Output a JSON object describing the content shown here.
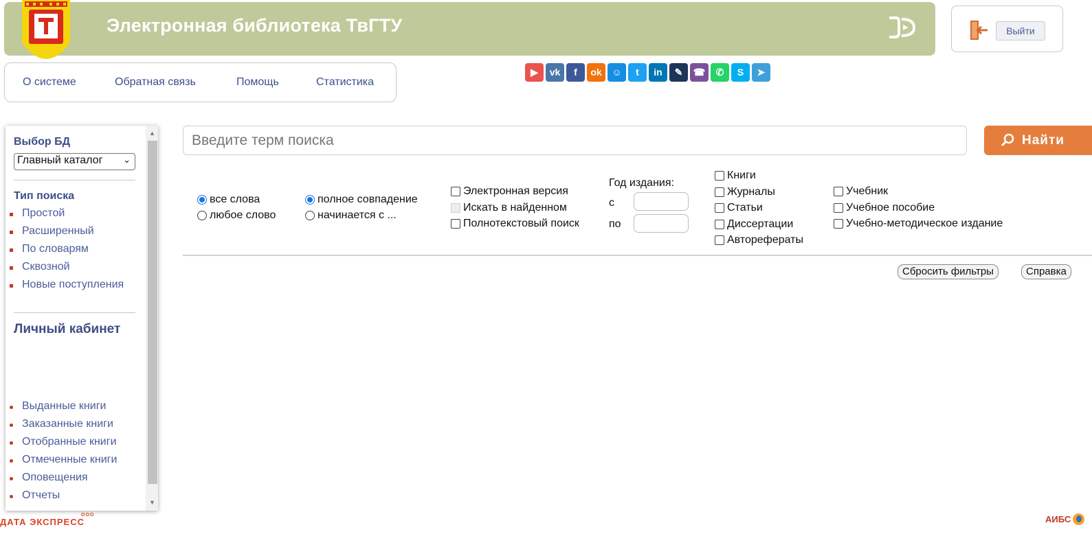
{
  "header": {
    "title": "Электронная библиотека ТвГТУ",
    "logout_label": "Выйти",
    "icons": {
      "logo": "city-coat-of-arms-logo",
      "mark": "reader-mark-icon",
      "logout": "logout-door-icon"
    }
  },
  "topnav": {
    "items": [
      "О системе",
      "Обратная связь",
      "Помощь",
      "Статистика"
    ]
  },
  "share": {
    "buttons": [
      {
        "icon": "share-collection-icon",
        "color": "#e9544f",
        "glyph": "▶"
      },
      {
        "icon": "vk-icon",
        "color": "#4a76a8",
        "glyph": "vk"
      },
      {
        "icon": "facebook-icon",
        "color": "#3b5998",
        "glyph": "f"
      },
      {
        "icon": "odnoklassniki-icon",
        "color": "#f2720c",
        "glyph": "ok"
      },
      {
        "icon": "moimir-icon",
        "color": "#168de2",
        "glyph": "☺"
      },
      {
        "icon": "twitter-icon",
        "color": "#1da1f2",
        "glyph": "t"
      },
      {
        "icon": "linkedin-icon",
        "color": "#0077b5",
        "glyph": "in"
      },
      {
        "icon": "livejournal-icon",
        "color": "#1d3557",
        "glyph": "✎"
      },
      {
        "icon": "viber-icon",
        "color": "#7b519d",
        "glyph": "☎"
      },
      {
        "icon": "whatsapp-icon",
        "color": "#25d366",
        "glyph": "✆"
      },
      {
        "icon": "skype-icon",
        "color": "#00aff0",
        "glyph": "S"
      },
      {
        "icon": "telegram-icon",
        "color": "#3ea0d8",
        "glyph": "➤"
      }
    ]
  },
  "sidebar": {
    "db_heading": "Выбор БД",
    "db_selected": "Главный каталог",
    "search_type_heading": "Тип поиска",
    "search_types": [
      "Простой",
      "Расширенный",
      "По словарям",
      "Сквозной",
      "Новые поступления"
    ],
    "cabinet_heading": "Личный кабинет",
    "cabinet_items": [
      "Выданные книги",
      "Заказанные книги",
      "Отобранные книги",
      "Отмеченные книги",
      "Оповещения",
      "Отчеты"
    ]
  },
  "search": {
    "placeholder": "Введите терм поиска",
    "button_label": "Найти",
    "words_all": "все слова",
    "words_any": "любое слово",
    "match_full": "полное совпадение",
    "match_start": "начинается с ...",
    "electronic": "Электронная версия",
    "search_in_found": "Искать в найденном",
    "fulltext": "Полнотекстовый поиск",
    "year_heading": "Год издания:",
    "year_from": "с",
    "year_to": "по",
    "types": [
      "Книги",
      "Журналы",
      "Статьи",
      "Диссертации",
      "Авторефераты"
    ],
    "edu_types": [
      "Учебник",
      "Учебное пособие",
      "Учебно-методическое издание"
    ],
    "reset_label": "Сбросить фильтры",
    "help_label": "Справка"
  },
  "footer": {
    "left_brand": "ДАТА ЭКСПРЕСС",
    "left_tag": "ООО",
    "right_brand": "АИБС"
  }
}
